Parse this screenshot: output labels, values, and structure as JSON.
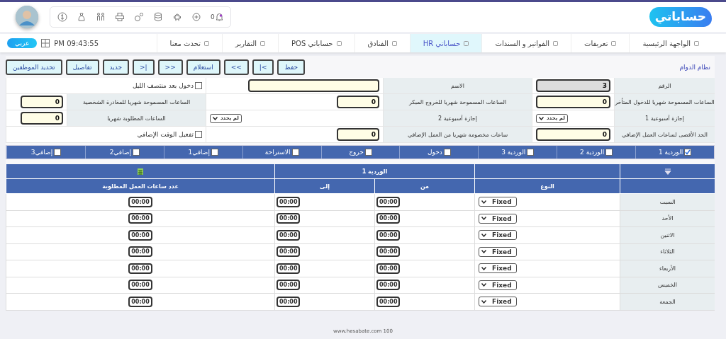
{
  "header": {
    "logo": "حساباتي",
    "notifications": "0"
  },
  "nav": {
    "tabs": [
      {
        "label": "الواجهة الرئيسية",
        "selected": false
      },
      {
        "label": "تعريفات",
        "selected": false
      },
      {
        "label": "الفواتير و السندات",
        "selected": false
      },
      {
        "label": "حساباتي HR",
        "selected": true
      },
      {
        "label": "الفنادق",
        "selected": false
      },
      {
        "label": "حساباتي POS",
        "selected": false
      },
      {
        "label": "التقارير",
        "selected": false
      },
      {
        "label": "تحدث معنا",
        "selected": false
      }
    ],
    "clock": "PM 09:43:55",
    "language_button": "عربي"
  },
  "page": {
    "title": "نظام الدوام",
    "toolbar": [
      "حفظ",
      "|<",
      "<<",
      "استعلام",
      ">>",
      ">|",
      "جديد",
      "تفاصيل",
      "تحديد الموظفين"
    ]
  },
  "form": {
    "rows": [
      [
        {
          "kind": "label",
          "text": "الرقم"
        },
        {
          "kind": "input",
          "value": "3",
          "disabled": true
        },
        {
          "kind": "label",
          "text": "الاسم"
        },
        {
          "kind": "input",
          "disabled": false
        },
        {
          "kind": "checkbox",
          "label": "دخول بعد منتصف الليل",
          "checked": false
        }
      ],
      [
        {
          "kind": "label",
          "text": "الساعات المسموحة شهريا للدخول المتأخر"
        },
        {
          "kind": "input",
          "value": "0",
          "disabled": false
        },
        {
          "kind": "label",
          "text": "الساعات المسموحة شهريا للخروج المبكر"
        },
        {
          "kind": "input",
          "value": "0",
          "disabled": false
        },
        {
          "kind": "label",
          "text": "الساعات المسموحة شهريا للمغادرة الشخصية"
        },
        {
          "kind": "input",
          "value": "0",
          "disabled": false
        }
      ],
      [
        {
          "kind": "label",
          "text": "إجازة أسبوعية 1"
        },
        {
          "kind": "select",
          "value": "لم يحدد"
        },
        {
          "kind": "label",
          "text": "إجازة أسبوعية 2"
        },
        {
          "kind": "select",
          "value": "لم يحدد"
        },
        {
          "kind": "label",
          "text": "الساعات المطلوبة شهريا"
        },
        {
          "kind": "input",
          "value": "0",
          "disabled": false
        }
      ],
      [
        {
          "kind": "label",
          "text": "الحد الأقصى لساعات العمل الإضافي"
        },
        {
          "kind": "input",
          "value": "0",
          "disabled": false
        },
        {
          "kind": "label",
          "text": "ساعات مخصومة شهريا من العمل الإضافي"
        },
        {
          "kind": "input",
          "value": "0",
          "disabled": false
        },
        {
          "kind": "checkbox",
          "label": "تفعيل الوقت الإضافي",
          "checked": false
        }
      ]
    ]
  },
  "shift_options": [
    {
      "label": "الوردية 1",
      "checked": true
    },
    {
      "label": "الوردية 2",
      "checked": false
    },
    {
      "label": "الوردية 3",
      "checked": false
    },
    {
      "label": "دخول",
      "checked": false
    },
    {
      "label": "خروج",
      "checked": false
    },
    {
      "label": "الاستراحة",
      "checked": false
    },
    {
      "label": "إضافي1",
      "checked": false
    },
    {
      "label": "إضافي2",
      "checked": false
    },
    {
      "label": "إضافي3",
      "checked": false
    }
  ],
  "grid": {
    "group_header": "الوردية 1",
    "columns": [
      "النوع",
      "من",
      "إلى",
      "عدد ساعات العمل المطلوبة"
    ],
    "rows": [
      {
        "day": "السبت",
        "type": "Fixed",
        "from": "00:00",
        "to": "00:00",
        "hours": "00:00"
      },
      {
        "day": "الأحد",
        "type": "Fixed",
        "from": "00:00",
        "to": "00:00",
        "hours": "00:00"
      },
      {
        "day": "الاثنين",
        "type": "Fixed",
        "from": "00:00",
        "to": "00:00",
        "hours": "00:00"
      },
      {
        "day": "الثلاثاء",
        "type": "Fixed",
        "from": "00:00",
        "to": "00:00",
        "hours": "00:00"
      },
      {
        "day": "الأربعاء",
        "type": "Fixed",
        "from": "00:00",
        "to": "00:00",
        "hours": "00:00"
      },
      {
        "day": "الخميس",
        "type": "Fixed",
        "from": "00:00",
        "to": "00:00",
        "hours": "00:00"
      },
      {
        "day": "الجمعة",
        "type": "Fixed",
        "from": "00:00",
        "to": "00:00",
        "hours": "00:00"
      }
    ]
  },
  "footer": "www.hesabate.com 100"
}
